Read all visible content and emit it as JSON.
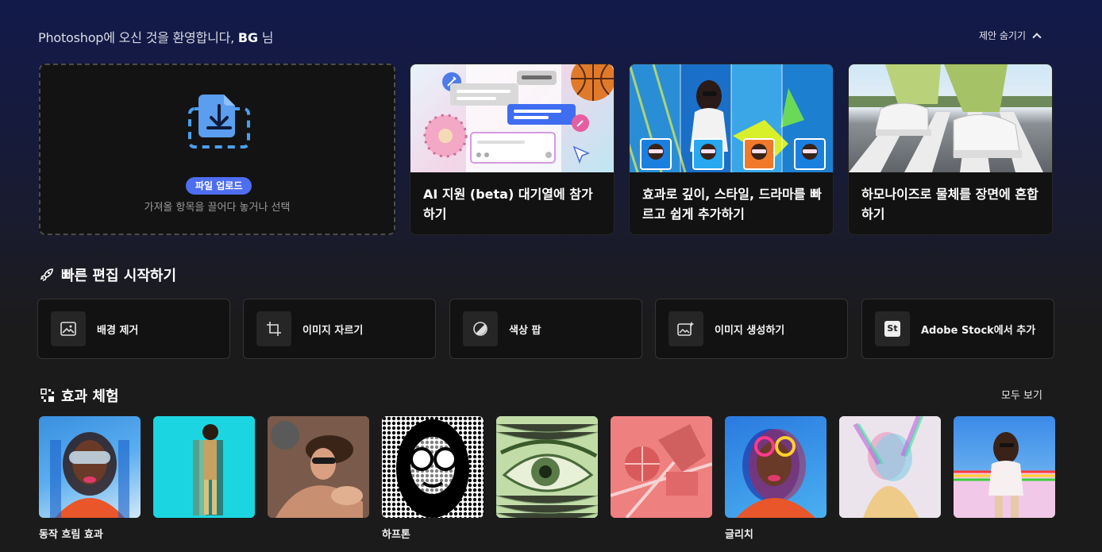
{
  "welcome": {
    "prefix": "Photoshop에 오신 것을 환영합니다, ",
    "user": "BG",
    "suffix": " 님"
  },
  "hide_suggestions": "제안 숨기기",
  "upload": {
    "button": "파일 업로드",
    "hint": "가져올 항목을 끌어다 놓거나 선택"
  },
  "promo_cards": [
    {
      "title": "AI 지원 (beta) 대기열에 참가하기"
    },
    {
      "title": "효과로 깊이, 스타일, 드라마를 빠르고 쉽게 추가하기"
    },
    {
      "title": "하모나이즈로 물체를 장면에 혼합하기"
    }
  ],
  "quick_edit": {
    "title": "빠른 편집 시작하기",
    "items": [
      {
        "label": "배경 제거",
        "icon": "image-icon"
      },
      {
        "label": "이미지 자르기",
        "icon": "crop-icon"
      },
      {
        "label": "색상 팝",
        "icon": "color-pop-icon"
      },
      {
        "label": "이미지 생성하기",
        "icon": "generate-image-icon"
      },
      {
        "label": "Adobe Stock에서 추가",
        "icon": "adobe-stock-icon",
        "badge": "St"
      }
    ]
  },
  "effects": {
    "title": "효과 체험",
    "see_all": "모두 보기",
    "labels": [
      "동작 흐림 효과",
      "하프톤",
      "글리치"
    ]
  }
}
